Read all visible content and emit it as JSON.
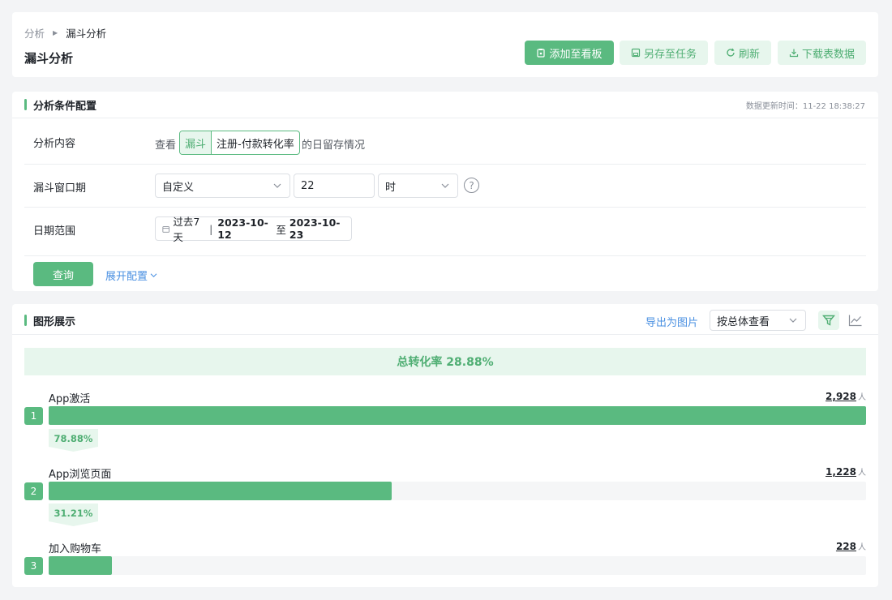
{
  "breadcrumb": {
    "root": "分析",
    "current": "漏斗分析"
  },
  "page_title": "漏斗分析",
  "toolbar": {
    "add_dashboard": "添加至看板",
    "save_task": "另存至任务",
    "refresh": "刷新",
    "download": "下载表数据"
  },
  "config": {
    "title": "分析条件配置",
    "update_time": "数据更新时间：11-22 18:38:27",
    "content": {
      "label": "分析内容",
      "prefix": "查看",
      "tag_type": "漏斗",
      "tag_name": "注册-付款转化率",
      "suffix": "的日留存情况"
    },
    "window": {
      "label": "漏斗窗口期",
      "mode": "自定义",
      "value": "22",
      "unit": "时",
      "help": "?"
    },
    "date": {
      "label": "日期范围",
      "preset": "过去7天",
      "separator": "|",
      "start": "2023-10-12",
      "to": "至",
      "end": "2023-10-23"
    },
    "query_label": "查询",
    "expand_label": "展开配置"
  },
  "chart_section": {
    "title": "图形展示",
    "export": "导出为图片",
    "view_mode": "按总体查看",
    "total_text": "总转化率 28.88%"
  },
  "chart_data": {
    "type": "bar",
    "categories": [
      "App激活",
      "App浏览页面",
      "加入购物车"
    ],
    "values": [
      2928,
      1228,
      228
    ],
    "value_labels": [
      "2,928",
      "1,228",
      "228"
    ],
    "unit": "人",
    "step_numbers": [
      "1",
      "2",
      "3"
    ],
    "conversion_rates": [
      "78.88%",
      "31.21%"
    ],
    "conversion_rate_values": [
      78.88,
      31.21
    ],
    "max": 2928,
    "color": "#5aba80"
  }
}
